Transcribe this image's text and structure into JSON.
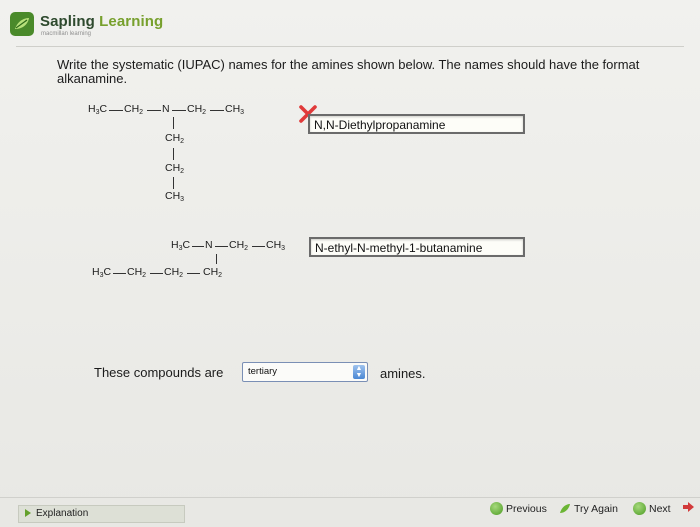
{
  "header": {
    "brand_part1": "Sapling ",
    "brand_part2": "Learning",
    "subtitle": "macmillan learning",
    "logo_icon": "sapling-leaf-icon"
  },
  "question": {
    "text": "Write the systematic (IUPAC) names for the amines shown below. The names should have the format alkanamine."
  },
  "structures": {
    "s1_row1": [
      "H3C",
      "CH2",
      "N",
      "CH2",
      "CH3"
    ],
    "s1_branch": [
      "CH2",
      "CH2",
      "CH3"
    ],
    "s2_row1": [
      "H3C",
      "N",
      "CH2",
      "CH3"
    ],
    "s2_row2": [
      "H3C",
      "CH2",
      "CH2",
      "CH2"
    ]
  },
  "answers": {
    "answer1": "N,N-Diethylpropanamine",
    "answer1_status": "incorrect",
    "answer2": "N-ethyl-N-methyl-1-butanamine"
  },
  "classification": {
    "prefix": "These compounds are",
    "selected": "tertiary",
    "suffix": "amines."
  },
  "footer": {
    "explanation": "Explanation",
    "previous": "Previous",
    "try_again": "Try Again",
    "next": "Next"
  },
  "colors": {
    "brand_green": "#77a02d",
    "wrong_red": "#e03a3a",
    "select_border": "#7a8fb5"
  }
}
